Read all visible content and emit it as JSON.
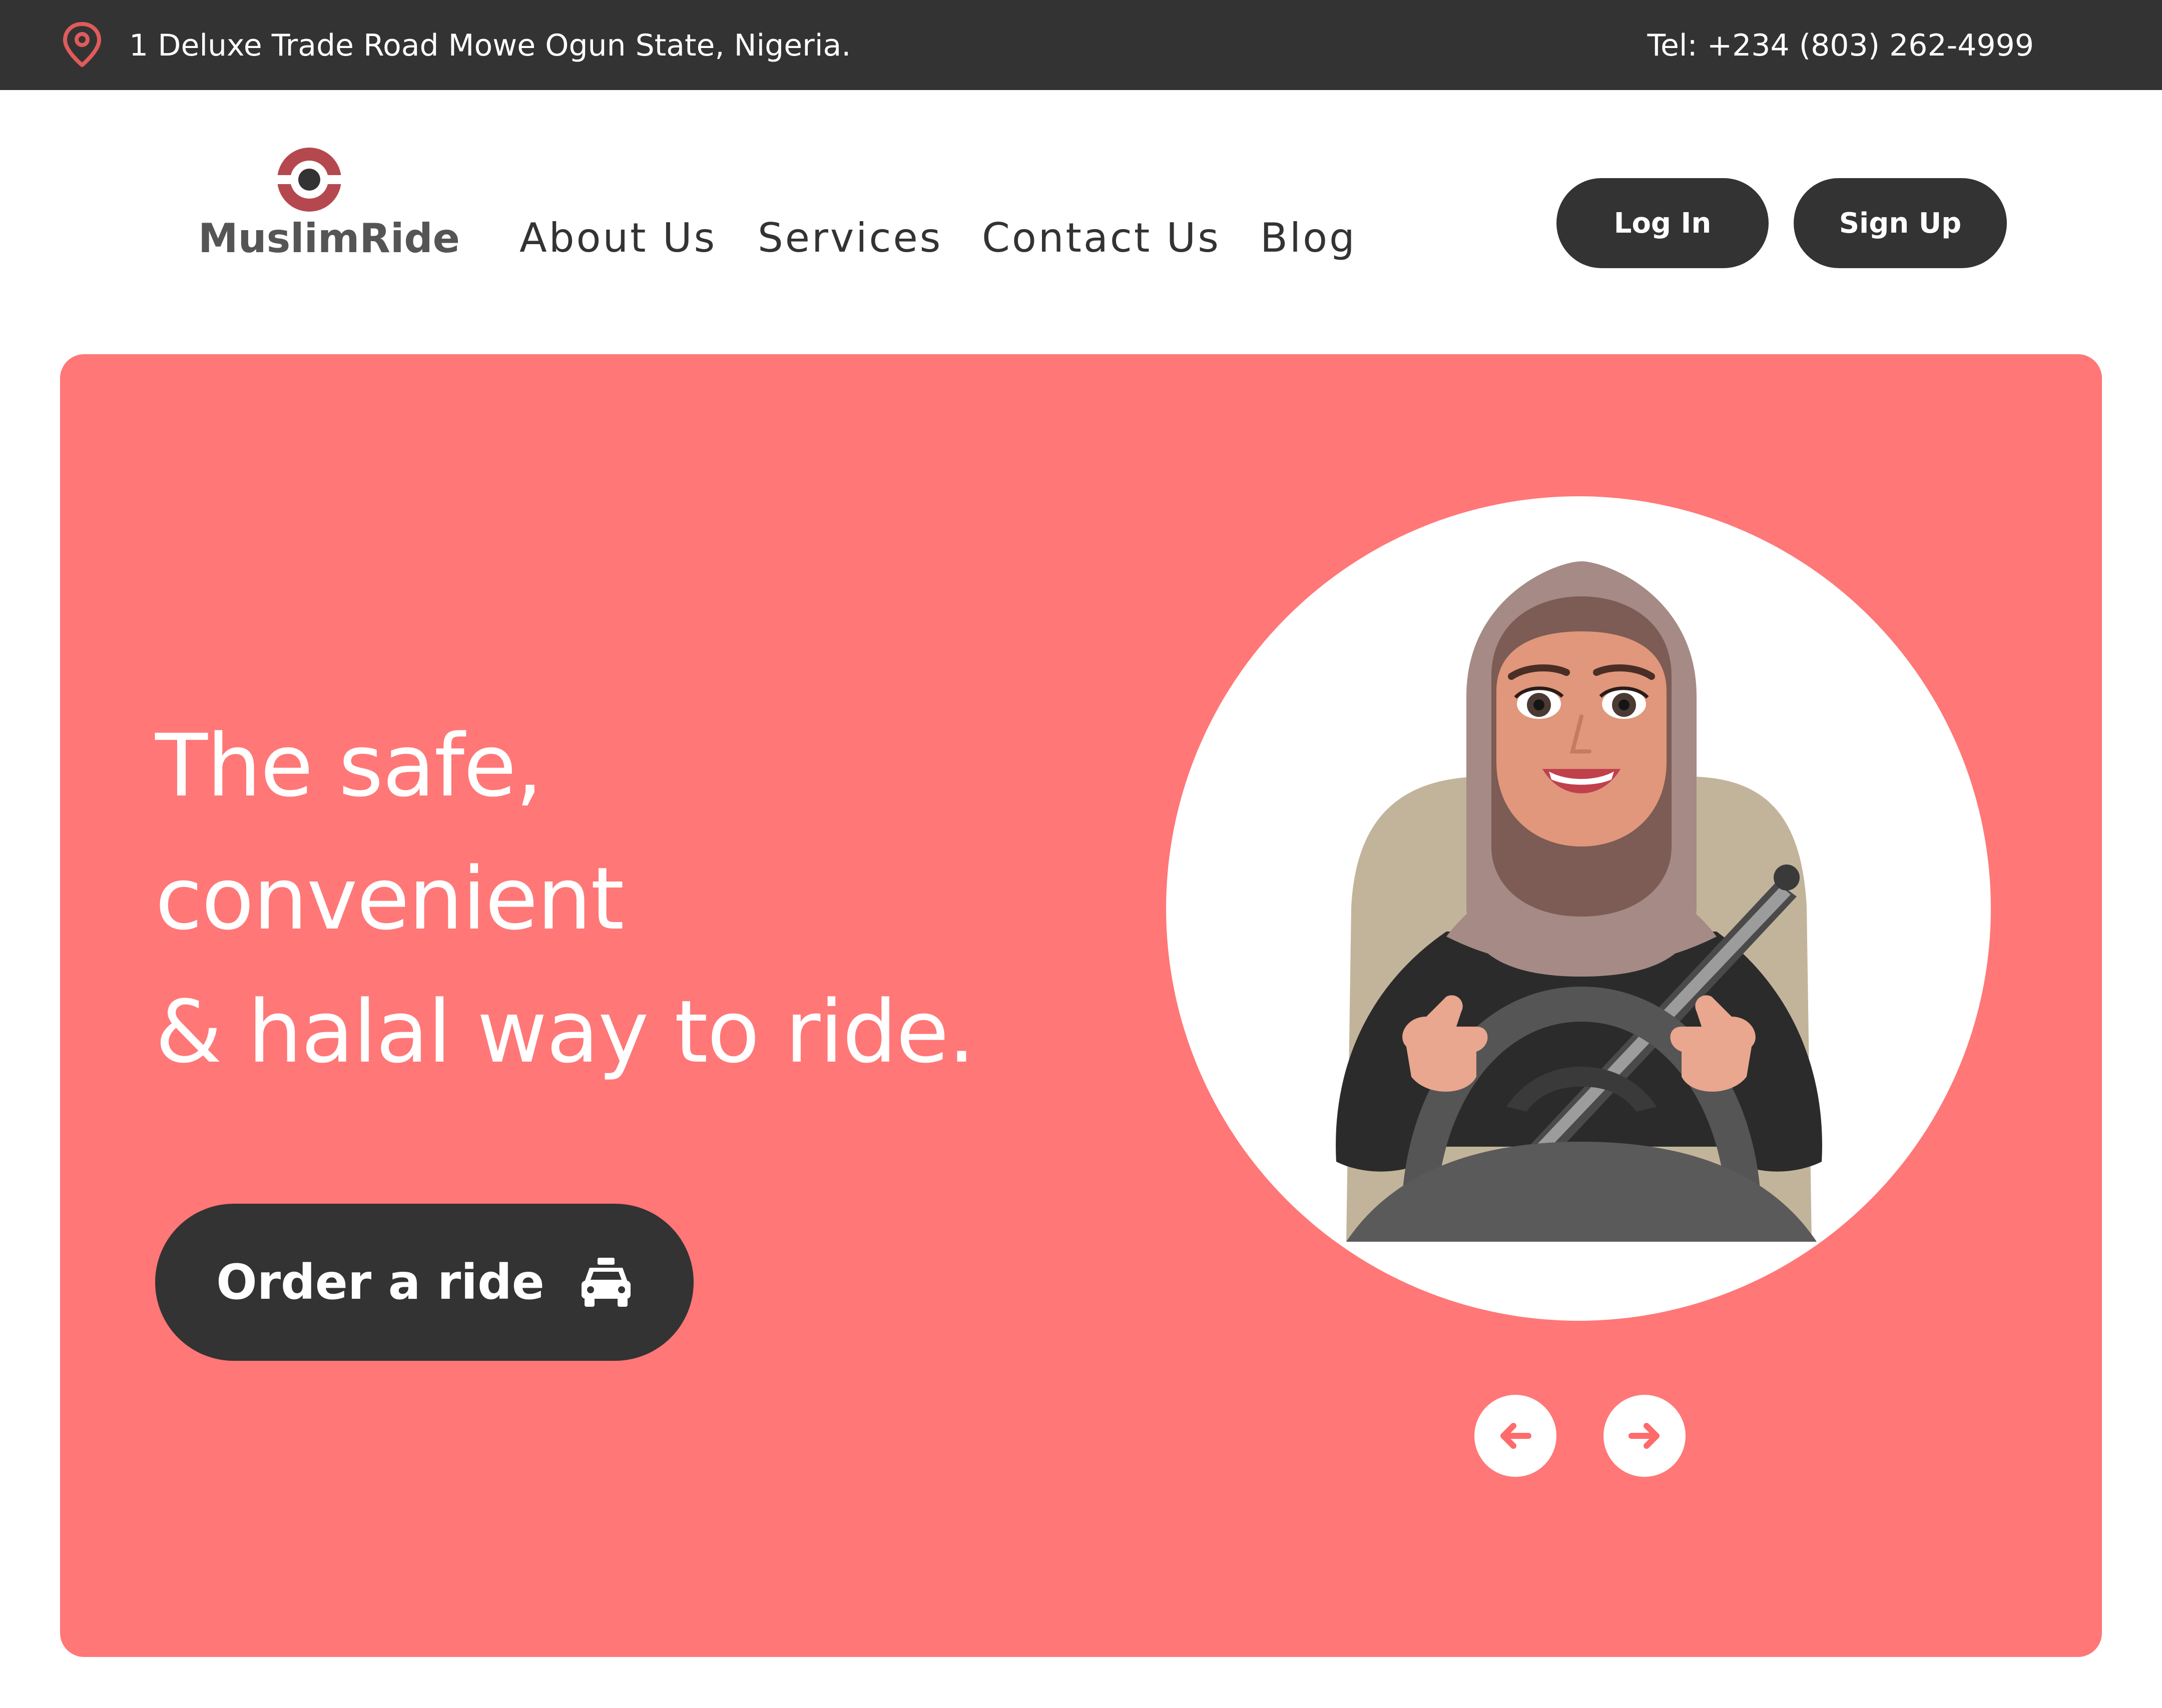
{
  "topbar": {
    "address": "1 Deluxe Trade Road Mowe Ogun State, Nigeria.",
    "phone": "Tel: +234 (803) 262-4999",
    "location_icon": "map-pin-icon"
  },
  "brand": {
    "name": "MuslimRide",
    "logo_icon": "target-eye-icon",
    "accent_color": "#b5484e"
  },
  "nav": {
    "items": [
      "About Us",
      "Services",
      "Contact Us",
      "Blog"
    ]
  },
  "auth": {
    "login_label": "Log In",
    "signup_label": "Sign Up"
  },
  "hero": {
    "background_color": "#ff7777",
    "headline_lines": [
      "The safe,",
      "convenient",
      "& halal way to ride."
    ],
    "cta_label": "Order a ride",
    "cta_icon": "taxi-icon",
    "illustration": "woman-in-hijab-driving-illustration",
    "carousel": {
      "prev_icon": "arrow-left-icon",
      "next_icon": "arrow-right-icon"
    }
  }
}
